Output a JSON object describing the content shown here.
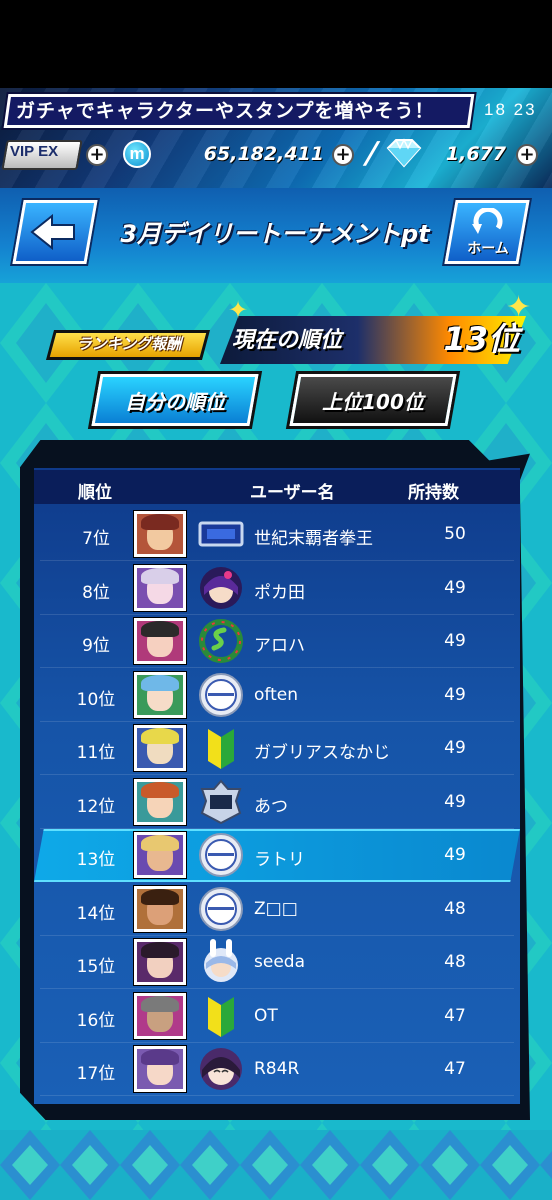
{
  "banner": {
    "text": "ガチャでキャラクターやスタンプを増やそう！"
  },
  "clock": "18 23",
  "currency": {
    "vip_badge": "VIP EX",
    "coin_symbol": "m",
    "coins": "65,182,411",
    "gems": "1,677",
    "plus_symbol": "+",
    "slash": "/"
  },
  "header": {
    "title": "3月デイリートーナメントpt",
    "home_label": "ホーム"
  },
  "ranking_reward_label": "ランキング報酬",
  "current_rank": {
    "label": "現在の順位",
    "value": "13位"
  },
  "tabs": [
    {
      "label": "自分の順位",
      "active": true
    },
    {
      "label": "上位100位",
      "active": false
    }
  ],
  "table": {
    "headers": {
      "rank": "順位",
      "name": "ユーザー名",
      "count": "所持数"
    },
    "rows": [
      {
        "rank": "7位",
        "name": "世紀末覇者拳王",
        "count": "50",
        "badge": "title-plate-icon"
      },
      {
        "rank": "8位",
        "name": "ポカ田",
        "count": "49",
        "badge": "anime-girl-icon"
      },
      {
        "rank": "9位",
        "name": "アロハ",
        "count": "49",
        "badge": "snake-wreath-icon"
      },
      {
        "rank": "10位",
        "name": "often",
        "count": "49",
        "badge": "msop-icon"
      },
      {
        "rank": "11位",
        "name": "ガブリアスなかじ",
        "count": "49",
        "badge": "beginner-mark-icon"
      },
      {
        "rank": "12位",
        "name": "あつ",
        "count": "49",
        "badge": "m2-ace-icon"
      },
      {
        "rank": "13位",
        "name": "ラトリ",
        "count": "49",
        "badge": "msop-icon",
        "highlight": true
      },
      {
        "rank": "14位",
        "name": "Z□□",
        "count": "48",
        "badge": "msop-icon"
      },
      {
        "rank": "15位",
        "name": "seeda",
        "count": "48",
        "badge": "bunny-girl-icon"
      },
      {
        "rank": "16位",
        "name": "OT",
        "count": "47",
        "badge": "beginner-mark-icon"
      },
      {
        "rank": "17位",
        "name": "R84R",
        "count": "47",
        "badge": "smiling-girl-icon"
      }
    ]
  },
  "colors": {
    "highlight_row": "#0ea9e8",
    "panel": "#1654a8",
    "main_bg": "#17b4c8",
    "reward_button": "#ffd21a",
    "active_tab": "#2ad3ff"
  }
}
